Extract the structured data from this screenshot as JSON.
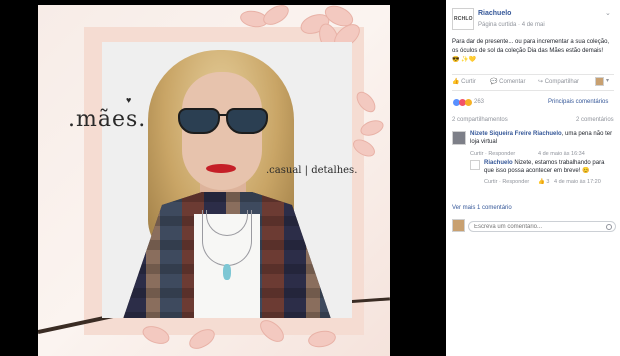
{
  "photo": {
    "heading": ".mães.",
    "tagline": ".casual | detalhes."
  },
  "post": {
    "page_name": "Riachuelo",
    "logo_text": "RCHLO",
    "meta": "Página curtida · 4 de mai",
    "more_icon": "chevron-down-icon",
    "text": "Para dar de presente... ou para incrementar a sua coleção, os óculos de sol da coleção Dia das Mães estão demais! 😎 ✨💛",
    "actions": {
      "like": "Curtir",
      "comment": "Comentar",
      "share": "Compartilhar"
    },
    "reaction_count": "263",
    "top_comments": "Principais comentários",
    "comments_count": "2 compartilhamentos",
    "comments_right": "2 comentários"
  },
  "comments": [
    {
      "author": "Nizete Siqueira Freire Riachuelo",
      "text": ", uma pena não ter loja virtual",
      "actions": "Curtir · Responder",
      "time": "4 de maio às 16:34"
    },
    {
      "author": "Riachuelo",
      "text": "Nizete, estamos trabalhando para que isso possa acontecer em breve! 😊",
      "actions": "Curtir · Responder",
      "likes": "3",
      "time": "4 de maio às 17:20"
    }
  ],
  "more_comments": "Ver mais 1 comentário",
  "comment_placeholder": "Escreva um comentário...",
  "colors": {
    "link": "#365899",
    "muted": "#90949c",
    "like_blue": "#5890ff",
    "love_red": "#f25268"
  }
}
